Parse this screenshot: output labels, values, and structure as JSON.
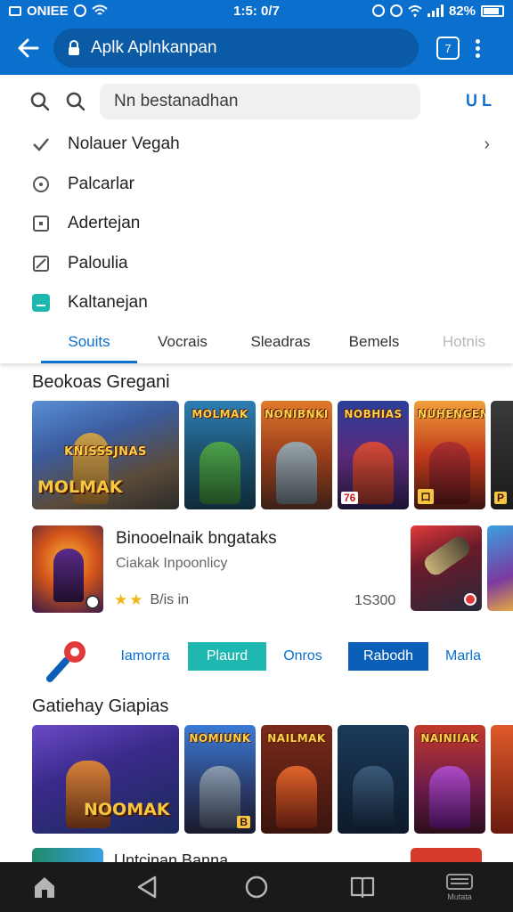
{
  "status_bar": {
    "carrier": "ONIEE",
    "time": "1:5: 0/7",
    "battery": "82%"
  },
  "app_bar": {
    "url_text": "Aplk Aplnkanpan",
    "tab_count": "7"
  },
  "search": {
    "value": "Nn bestanadhan",
    "action_label": "ᑌ L"
  },
  "menu": {
    "items": [
      {
        "label": "Nolauer Vegah",
        "icon": "check-icon"
      },
      {
        "label": "Palcarlar",
        "icon": "clock-icon"
      },
      {
        "label": "Adertejan",
        "icon": "square-dot-icon"
      },
      {
        "label": "Paloulia",
        "icon": "slash-box-icon"
      },
      {
        "label": "Kaltanejan",
        "icon": "teal-box-icon"
      }
    ]
  },
  "tabs": [
    {
      "label": "Souits"
    },
    {
      "label": "Vocrais"
    },
    {
      "label": "Sleadras"
    },
    {
      "label": "Bemels"
    },
    {
      "label": "Hotnis"
    }
  ],
  "section1": {
    "title": "Beokoas Gregani",
    "tiles": [
      {
        "label": "KNISSSJNAS",
        "big": "MOLMAK"
      },
      {
        "label": "MOLMAK",
        "big": ""
      },
      {
        "label": "NONIBNKI",
        "big": ""
      },
      {
        "label": "NOBHIAS",
        "big": ""
      },
      {
        "label": "NUHENGEN",
        "big": ""
      },
      {
        "label": "",
        "big": ""
      }
    ],
    "tile_badge_1": "76",
    "tile_badge_2": "ロ",
    "tile_badge_3": "P"
  },
  "featured": {
    "title": "Binooelnaik bngataks",
    "subtitle": "Ciakak Inpoonlicy",
    "rating_text": "B/is in",
    "price": "1S300"
  },
  "chips": [
    {
      "label": "Iamorra"
    },
    {
      "label": "Plaurd"
    },
    {
      "label": "Onros"
    },
    {
      "label": "Rabodh"
    },
    {
      "label": "Marla"
    }
  ],
  "section2": {
    "title": "Gatiehay Giapias",
    "tiles": [
      {
        "label": "NOOMAK"
      },
      {
        "label": "NOMIUNK"
      },
      {
        "label": "NAILMAK"
      },
      {
        "label": ""
      },
      {
        "label": "NAINIIAK"
      },
      {
        "label": ""
      }
    ],
    "tile_badge": "B",
    "partial_title": "Untcinan Banna"
  },
  "nav": {
    "last_caption": "Mutata"
  },
  "colors": {
    "brand_blue": "#0b6fce",
    "teal": "#1fb8b0",
    "nav_bg": "#1a1a1a"
  }
}
